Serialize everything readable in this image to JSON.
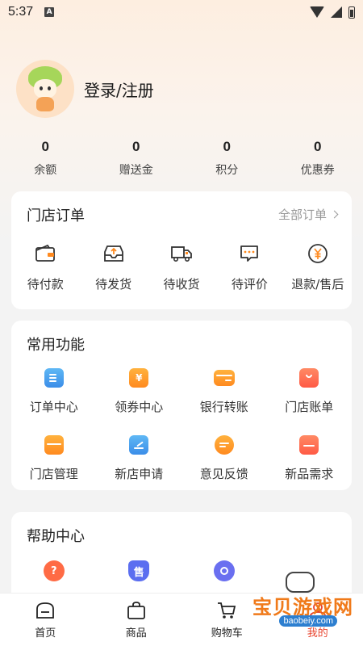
{
  "status_bar": {
    "time": "5:37",
    "notif_icon": "A"
  },
  "profile": {
    "login_label": "登录/注册"
  },
  "stats": [
    {
      "value": "0",
      "label": "余额"
    },
    {
      "value": "0",
      "label": "赠送金"
    },
    {
      "value": "0",
      "label": "积分"
    },
    {
      "value": "0",
      "label": "优惠券"
    }
  ],
  "orders": {
    "title": "门店订单",
    "all_link": "全部订单",
    "items": [
      {
        "label": "待付款",
        "icon": "wallet-icon"
      },
      {
        "label": "待发货",
        "icon": "outbox-icon"
      },
      {
        "label": "待收货",
        "icon": "truck-icon"
      },
      {
        "label": "待评价",
        "icon": "comment-icon"
      },
      {
        "label": "退款/售后",
        "icon": "yen-circle-icon"
      }
    ]
  },
  "functions": {
    "title": "常用功能",
    "items": [
      {
        "label": "订单中心",
        "icon": "order-center-icon"
      },
      {
        "label": "领券中心",
        "icon": "coupon-icon"
      },
      {
        "label": "银行转账",
        "icon": "bank-card-icon"
      },
      {
        "label": "门店账单",
        "icon": "store-bill-icon"
      },
      {
        "label": "门店管理",
        "icon": "store-manage-icon"
      },
      {
        "label": "新店申请",
        "icon": "new-store-icon"
      },
      {
        "label": "意见反馈",
        "icon": "feedback-icon"
      },
      {
        "label": "新品需求",
        "icon": "new-product-icon"
      }
    ]
  },
  "help": {
    "title": "帮助中心",
    "items": [
      {
        "icon": "question-icon"
      },
      {
        "icon": "after-sale-icon",
        "glyph": "售"
      },
      {
        "icon": "ring-icon"
      }
    ]
  },
  "tabbar": [
    {
      "label": "首页",
      "icon": "home-icon"
    },
    {
      "label": "商品",
      "icon": "bag-icon"
    },
    {
      "label": "购物车",
      "icon": "cart-icon"
    },
    {
      "label": "我的",
      "icon": "user-icon"
    }
  ],
  "watermark": {
    "text": "宝贝游戏网",
    "url": "baobeiy.com"
  },
  "colors": {
    "accent_orange": "#ff8a1f",
    "accent_blue": "#3b8de8",
    "accent_red": "#ff5a45"
  }
}
